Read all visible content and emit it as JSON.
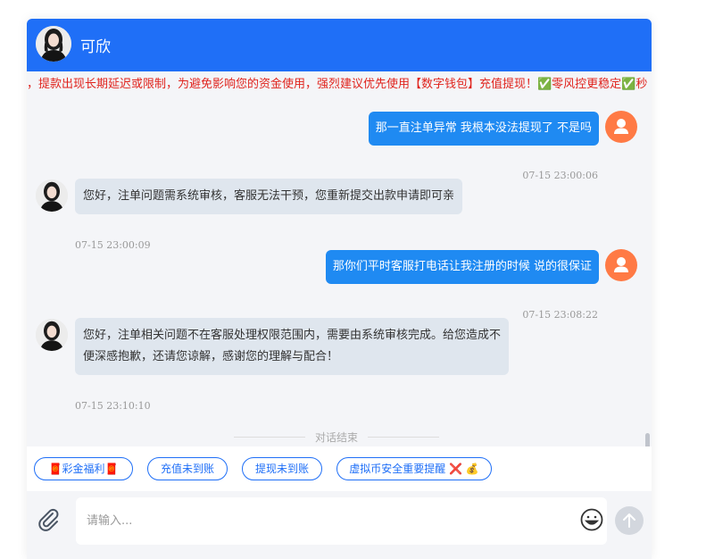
{
  "header": {
    "agent_name": "可欣"
  },
  "notice": {
    "text": "，提款出现长期延迟或限制，为避免影响您的资金使用，强烈建议优先使用【数字钱包】充值提现！✅零风控更稳定✅秒"
  },
  "messages": [
    {
      "from": "user",
      "text": "那一直注单异常 我根本没法提现了 不是吗",
      "time": "07-15 23:00:06"
    },
    {
      "from": "agent",
      "text": "您好，注单问题需系统审核，客服无法干预，您重新提交出款申请即可亲",
      "time": "07-15 23:00:09"
    },
    {
      "from": "user",
      "text": "那你们平时客服打电话让我注册的时候 说的很保证",
      "time": "07-15 23:08:22"
    },
    {
      "from": "agent",
      "line1": "您好，注单相关问题不在客服处理权限范围内，需要由系统审核完成。给您造成不",
      "line2": "便深感抱歉，还请您谅解，感谢您的理解与配合！",
      "time": "07-15 23:10:10"
    }
  ],
  "end_label": "对话结束",
  "quick_replies": [
    "🧧彩金福利🧧",
    "充值未到账",
    "提现未到账",
    "虚拟币安全重要提醒 ❌ 💰"
  ],
  "input": {
    "placeholder": "请输入..."
  },
  "colors": {
    "header": "#1f6ff7",
    "user_bubble": "#1f8af2",
    "agent_bubble": "#dfe6ee",
    "user_avatar": "#ff7a45",
    "notice_text": "#e0231c"
  }
}
